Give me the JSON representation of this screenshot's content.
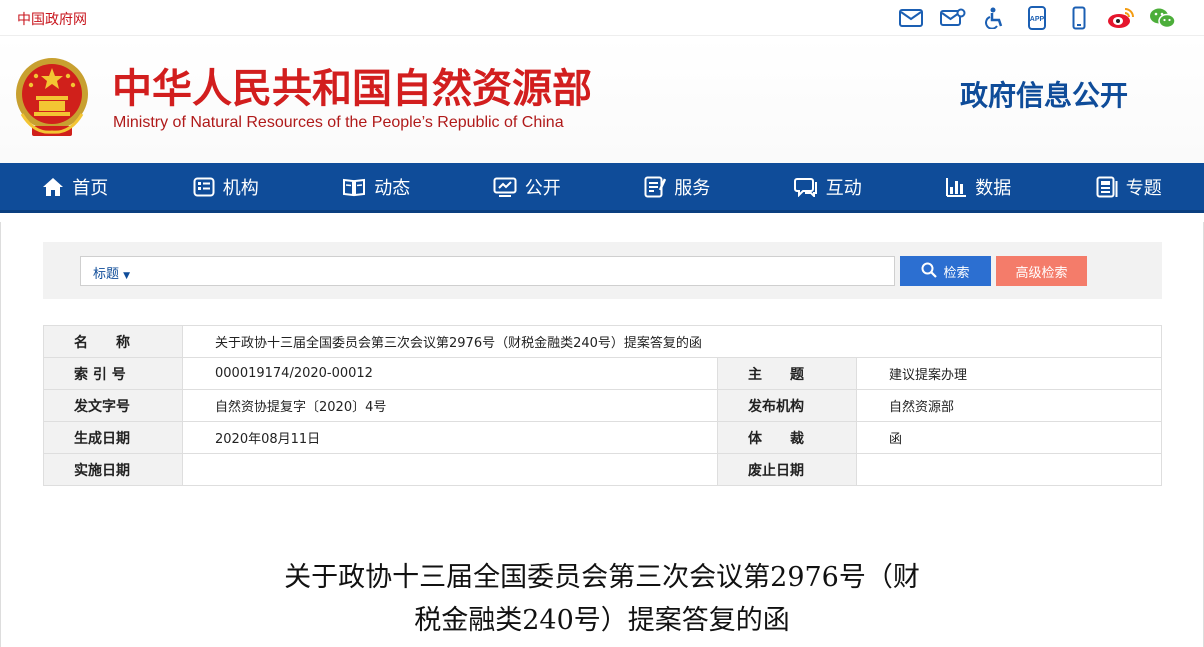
{
  "topbar": {
    "gov_link": "中国政府网",
    "icons": [
      "mail-icon",
      "email-gear-icon",
      "accessibility-icon",
      "app-icon",
      "mobile-icon",
      "weibo-icon",
      "wechat-icon"
    ],
    "app_text": "APP"
  },
  "header": {
    "title_cn": "中华人民共和国自然资源部",
    "title_en": "Ministry of Natural Resources of the People’s Republic of China",
    "section": "政府信息公开"
  },
  "nav": {
    "items": [
      {
        "label": "首页",
        "icon": "home-icon"
      },
      {
        "label": "机构",
        "icon": "org-icon"
      },
      {
        "label": "动态",
        "icon": "news-icon"
      },
      {
        "label": "公开",
        "icon": "open-icon"
      },
      {
        "label": "服务",
        "icon": "service-icon"
      },
      {
        "label": "互动",
        "icon": "chat-icon"
      },
      {
        "label": "数据",
        "icon": "data-icon"
      },
      {
        "label": "专题",
        "icon": "topic-icon"
      }
    ]
  },
  "search": {
    "type_label": "标题",
    "type_arrow": "▼",
    "search_button": "检索",
    "advanced_button": "高级检索",
    "input_value": ""
  },
  "meta": {
    "name_label": "名　　称",
    "name_value": "关于政协十三届全国委员会第三次会议第2976号（财税金融类240号）提案答复的函",
    "index_label": "索 引 号",
    "index_value": "000019174/2020-00012",
    "subject_label": "主　　题",
    "subject_value": "建议提案办理",
    "docno_label": "发文字号",
    "docno_value": "自然资协提复字〔2020〕4号",
    "issuer_label": "发布机构",
    "issuer_value": "自然资源部",
    "date_label": "生成日期",
    "date_value": "2020年08月11日",
    "genre_label": "体　　裁",
    "genre_value": "函",
    "effective_label": "实施日期",
    "effective_value": "",
    "expire_label": "废止日期",
    "expire_value": ""
  },
  "document": {
    "title_line1": "关于政协十三届全国委员会第三次会议第2976号（财",
    "title_line2": "税金融类240号）提案答复的函"
  },
  "colors": {
    "brand_red": "#d21e1e",
    "nav_blue": "#0f4c99",
    "search_blue": "#2c6fd1",
    "advanced_salmon": "#f47c6a"
  }
}
